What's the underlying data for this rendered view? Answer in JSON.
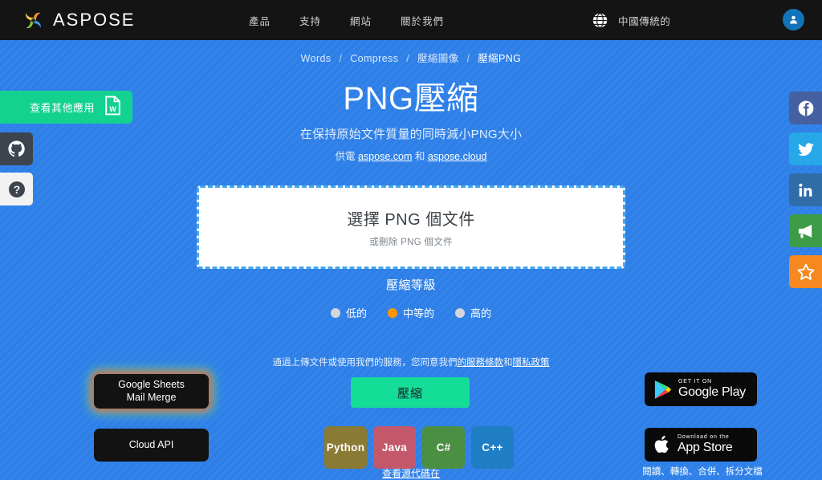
{
  "topbar": {
    "brand_name": "ASPOSE",
    "brand_icon": "aspose-swirl-logo",
    "nav": [
      {
        "label": "產品",
        "name": "products"
      },
      {
        "label": "支持",
        "name": "support"
      },
      {
        "label": "網站",
        "name": "website"
      },
      {
        "label": "關於我們",
        "name": "about-us"
      }
    ],
    "language": {
      "label": "中國傳統的",
      "icon": "globe-icon"
    },
    "account": {
      "icon": "user-avatar-icon"
    },
    "bg_color": "#141414"
  },
  "breadcrumb": {
    "items": [
      "Words",
      "Compress",
      "壓縮圖像",
      "壓縮PNG"
    ],
    "separator": "/"
  },
  "hero": {
    "title": "PNG壓縮",
    "subtitle": "在保持原始文件質量的同時減小PNG大小",
    "powered_prefix": "供電 ",
    "powered_link1": "aspose.com",
    "powered_mid": " 和 ",
    "powered_link2": "aspose.cloud"
  },
  "dropzone": {
    "title": "選擇 PNG 個文件",
    "subtitle": "或刪除 PNG 個文件"
  },
  "compression": {
    "title": "壓縮等級",
    "options": [
      {
        "label": "低的",
        "value": "low",
        "selected": false
      },
      {
        "label": "中等的",
        "value": "medium",
        "selected": true
      },
      {
        "label": "高的",
        "value": "high",
        "selected": false
      }
    ],
    "selected_color": "#ff9500",
    "unselected_color": "#d4d7da"
  },
  "terms": {
    "text_before": "通過上傳文件或使用我們的服務，您同意我們",
    "link_terms": "的服務條款",
    "text_mid": "和",
    "link_privacy": "隱私政策"
  },
  "action": {
    "compress_label": "壓縮",
    "compress_color": "#13dd96"
  },
  "code_samples": {
    "badges": [
      {
        "label": "Python",
        "color": "#8a7a33"
      },
      {
        "label": "Java",
        "color": "#c4586b"
      },
      {
        "label": "C#",
        "color": "#4b8f43"
      },
      {
        "label": "C++",
        "color": "#1f7ec4"
      }
    ],
    "source_link": "查看源代碼在"
  },
  "left_rail": {
    "other_apps_label": "查看其他應用",
    "other_apps_icon": "word-document-icon",
    "other_apps_color": "#13d290",
    "tabs": [
      {
        "name": "github-icon",
        "bg": "#3d444d"
      },
      {
        "name": "help-question-icon",
        "bg": "#f2f2f2"
      }
    ]
  },
  "promos": {
    "gsheets_line1": "Google Sheets",
    "gsheets_line2": "Mail Merge",
    "cloud_api_label": "Cloud API"
  },
  "stores": {
    "google_play": {
      "top": "GET IT ON",
      "main": "Google Play",
      "icon": "google-play-icon"
    },
    "app_store": {
      "top": "Download on the",
      "main": "App Store",
      "icon": "apple-logo-icon"
    },
    "caption": "閱讀、轉換、合併、拆分文檔"
  },
  "social": [
    {
      "name": "facebook-icon",
      "color": "#4460a0"
    },
    {
      "name": "twitter-icon",
      "color": "#26a7e8"
    },
    {
      "name": "linkedin-icon",
      "color": "#2f6ca8"
    },
    {
      "name": "megaphone-icon",
      "color": "#3c9b45"
    },
    {
      "name": "star-icon",
      "color": "#f5891f"
    }
  ],
  "page": {
    "background_color": "#2e80e8"
  }
}
